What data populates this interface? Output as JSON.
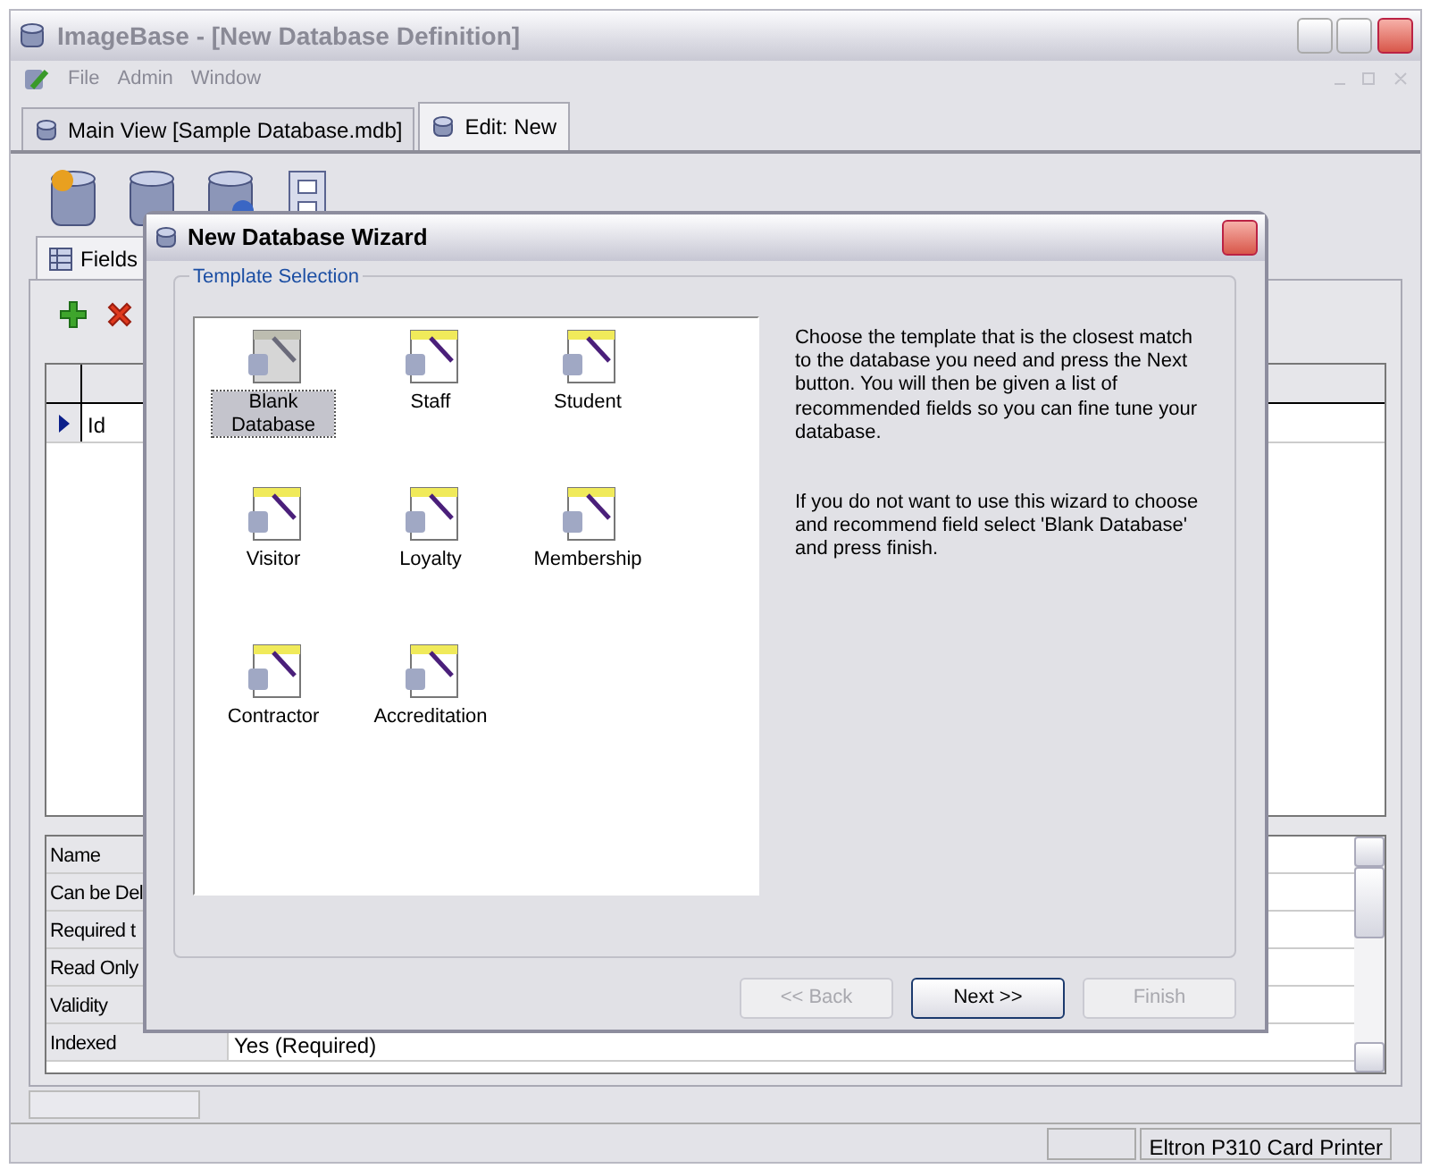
{
  "window": {
    "title": "ImageBase - [New Database Definition]"
  },
  "menu": [
    "File",
    "Admin",
    "Window"
  ],
  "document_tabs": [
    {
      "label": "Main View [Sample Database.mdb]",
      "selected": false
    },
    {
      "label": "Edit: New",
      "selected": true
    }
  ],
  "sub_tabs": [
    {
      "label": "Fields",
      "selected": true
    }
  ],
  "fields_grid": {
    "rows": [
      {
        "name": "Id",
        "current": true
      }
    ]
  },
  "properties": [
    {
      "name": "Name"
    },
    {
      "name": "Can be Del"
    },
    {
      "name": "Required t"
    },
    {
      "name": "Read Only"
    },
    {
      "name": "Validity"
    },
    {
      "name": "Indexed",
      "value": "Yes (Required)"
    }
  ],
  "status_bar": {
    "printer": "Eltron P310 Card Printer"
  },
  "dialog": {
    "title": "New Database Wizard",
    "group_title": "Template Selection",
    "templates": [
      {
        "label": "Blank Database",
        "kind": "blank",
        "selected": true
      },
      {
        "label": "Staff",
        "kind": "wizard",
        "selected": false
      },
      {
        "label": "Student",
        "kind": "wizard",
        "selected": false
      },
      {
        "label": "Visitor",
        "kind": "wizard",
        "selected": false
      },
      {
        "label": "Loyalty",
        "kind": "wizard",
        "selected": false
      },
      {
        "label": "Membership",
        "kind": "wizard",
        "selected": false
      },
      {
        "label": "Contractor",
        "kind": "wizard",
        "selected": false
      },
      {
        "label": "Accreditation",
        "kind": "wizard",
        "selected": false
      }
    ],
    "description": [
      "Choose the template that is the closest match to the database you need and press the Next button. You will then be given a list of recommended fields so you can fine tune your database.",
      "If you do not want to use this wizard to choose and recommend field select 'Blank Database' and press finish."
    ],
    "buttons": [
      {
        "label": "<< Back",
        "disabled": true,
        "default": false
      },
      {
        "label": "Next >>",
        "disabled": false,
        "default": true
      },
      {
        "label": "Finish",
        "disabled": true,
        "default": false
      }
    ]
  }
}
